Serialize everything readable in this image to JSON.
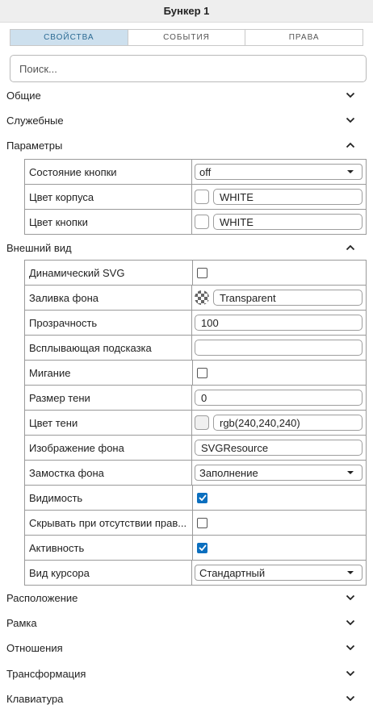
{
  "title": "Бункер 1",
  "tabs": [
    {
      "label": "СВОЙСТВА",
      "active": true
    },
    {
      "label": "СОБЫТИЯ",
      "active": false
    },
    {
      "label": "ПРАВА",
      "active": false
    }
  ],
  "search": {
    "placeholder": "Поиск...",
    "value": ""
  },
  "sections": {
    "general": {
      "label": "Общие",
      "expanded": false
    },
    "service": {
      "label": "Служебные",
      "expanded": false
    },
    "params": {
      "label": "Параметры",
      "expanded": true
    },
    "appearance": {
      "label": "Внешний вид",
      "expanded": true
    },
    "location": {
      "label": "Расположение",
      "expanded": false
    },
    "frame": {
      "label": "Рамка",
      "expanded": false
    },
    "relations": {
      "label": "Отношения",
      "expanded": false
    },
    "transform": {
      "label": "Трансформация",
      "expanded": false
    },
    "keyboard": {
      "label": "Клавиатура",
      "expanded": false
    }
  },
  "params": {
    "button_state": {
      "label": "Состояние кнопки",
      "value": "off"
    },
    "body_color": {
      "label": "Цвет корпуса",
      "value": "WHITE"
    },
    "button_color": {
      "label": "Цвет кнопки",
      "value": "WHITE"
    }
  },
  "appearance": {
    "dynamic_svg": {
      "label": "Динамический SVG",
      "checked": false
    },
    "bg_fill": {
      "label": "Заливка фона",
      "value": "Transparent"
    },
    "opacity": {
      "label": "Прозрачность",
      "value": "100"
    },
    "tooltip": {
      "label": "Всплывающая подсказка",
      "value": ""
    },
    "blink": {
      "label": "Мигание",
      "checked": false
    },
    "shadow_size": {
      "label": "Размер тени",
      "value": "0"
    },
    "shadow_color": {
      "label": "Цвет тени",
      "value": "rgb(240,240,240)"
    },
    "bg_image": {
      "label": "Изображение фона",
      "value": "SVGResource"
    },
    "bg_tiling": {
      "label": "Замостка фона",
      "value": "Заполнение"
    },
    "visibility": {
      "label": "Видимость",
      "checked": true
    },
    "hide_no_rights": {
      "label": "Скрывать при отсутствии прав...",
      "checked": false
    },
    "active": {
      "label": "Активность",
      "checked": true
    },
    "cursor": {
      "label": "Вид курсора",
      "value": "Стандартный"
    }
  },
  "colors": {
    "accent": "#0b6fbf",
    "tab_active_bg": "#cde0ee",
    "tab_active_text": "#2b6a93"
  }
}
